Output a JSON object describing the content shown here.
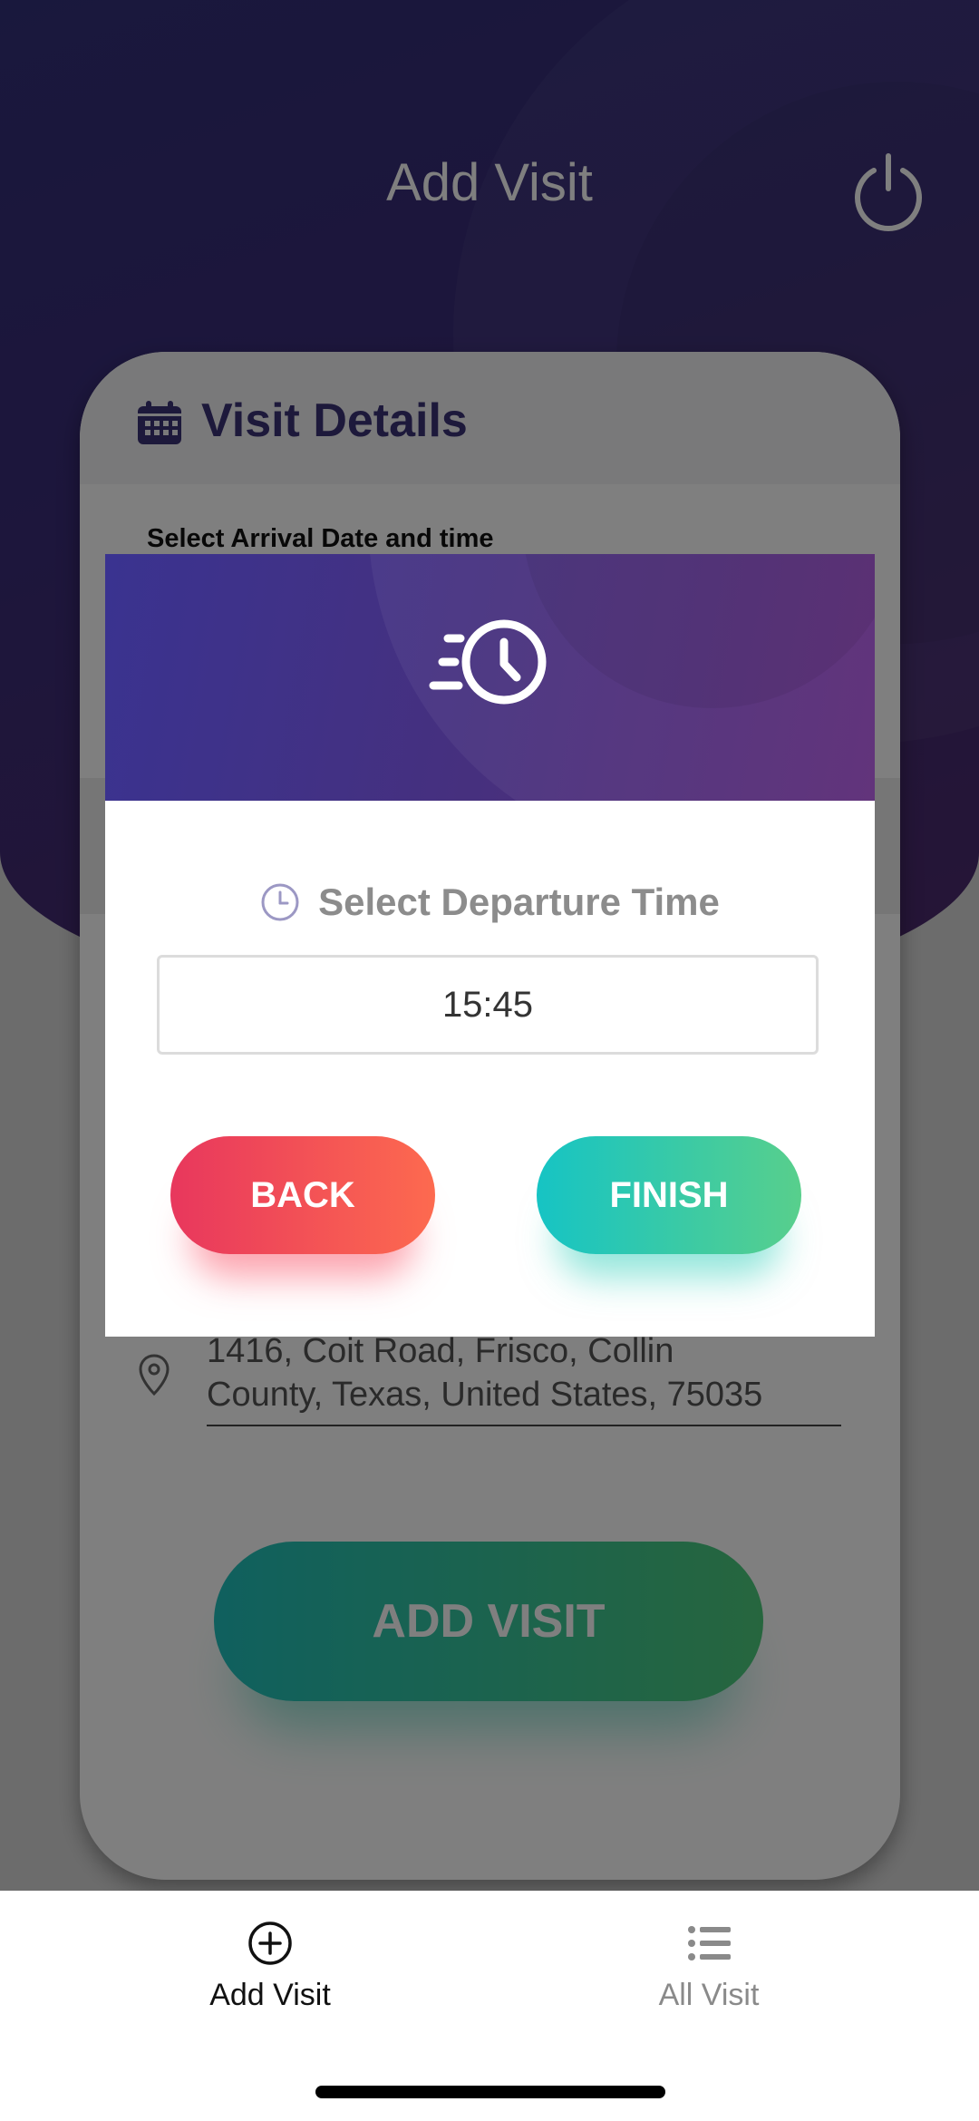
{
  "app_bar": {
    "title": "Add Visit",
    "power_icon": "power-icon"
  },
  "card": {
    "title": "Visit Details",
    "title_icon": "calendar-icon",
    "arrival_label": "Select Arrival Date and time",
    "address_line1": "1416, Coit Road, Frisco, Collin",
    "address_line2": "County, Texas, United States, 75035",
    "address_icon": "location-pin-icon",
    "add_visit_button": "ADD VISIT"
  },
  "modal": {
    "header_icon": "fast-clock-icon",
    "prompt": "Select Departure Time",
    "prompt_icon": "clock-icon",
    "time_value": "15:45",
    "back_button": "BACK",
    "finish_button": "FINISH"
  },
  "bottom_nav": {
    "items": [
      {
        "label": "Add Visit",
        "icon": "plus-circle-icon",
        "active": true
      },
      {
        "label": "All Visit",
        "icon": "list-icon",
        "active": false
      }
    ]
  },
  "colors": {
    "brand_purple": "#3b3276",
    "back_gradient": [
      "#e8375d",
      "#fd6a4f"
    ],
    "finish_gradient": [
      "#16c4c4",
      "#58cf8c"
    ],
    "overlay": "rgba(0,0,0,0.5)"
  }
}
